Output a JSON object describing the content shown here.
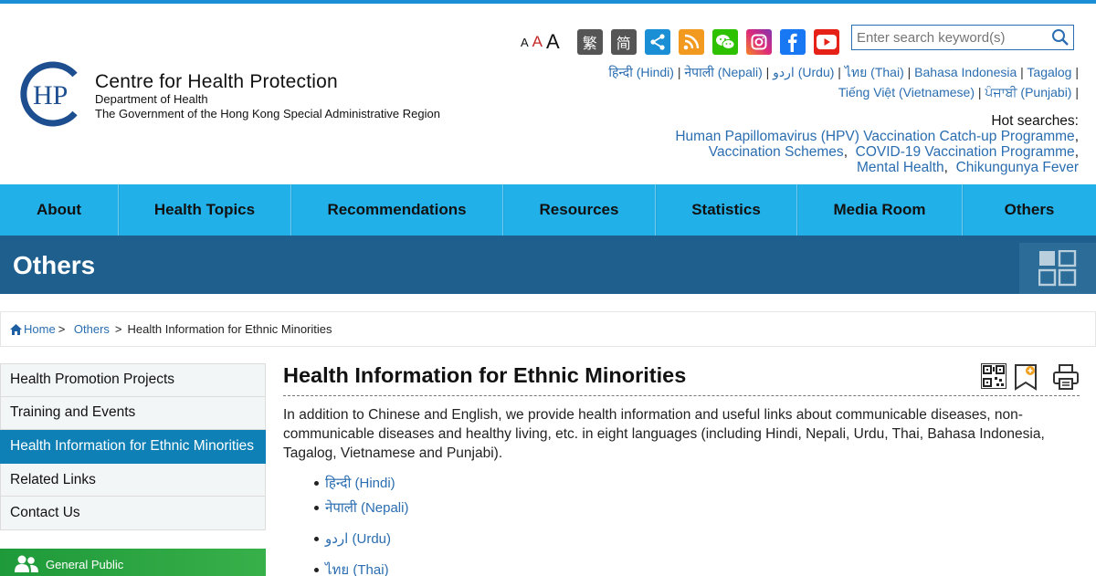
{
  "header": {
    "org_name": "Centre for Health Protection",
    "dept": "Department of Health",
    "gov": "The Government of the Hong Kong Special Administrative Region",
    "logo_letters": "HP",
    "font_sizes": [
      "A",
      "A",
      "A"
    ],
    "trad_chinese": "繁",
    "simp_chinese": "简",
    "search_placeholder": "Enter search keyword(s)",
    "languages_line1": [
      "हिन्दी (Hindi)",
      "नेपाली (Nepali)",
      "اردو (Urdu)",
      "ไทย (Thai)",
      "Bahasa Indonesia",
      "Tagalog"
    ],
    "languages_line2": [
      "Tiếng Việt (Vietnamese)",
      "ਪੰਜਾਬੀ (Punjabi)"
    ],
    "sep": "|",
    "hot_title": "Hot searches:",
    "hot_links": [
      "Human Papillomavirus (HPV) Vaccination Catch-up Programme",
      "Vaccination Schemes",
      "COVID-19 Vaccination Programme",
      "Mental Health",
      "Chikungunya Fever"
    ],
    "comma": ","
  },
  "nav": [
    "About",
    "Health Topics",
    "Recommendations",
    "Resources",
    "Statistics",
    "Media Room",
    "Others"
  ],
  "banner": {
    "title": "Others"
  },
  "breadcrumb": {
    "home": "Home",
    "sep": ">",
    "others": "Others",
    "current": "Health Information for Ethnic Minorities"
  },
  "sidebar": {
    "items": [
      "Health Promotion Projects",
      "Training and Events",
      "Health Information for Ethnic Minorities",
      "Related Links",
      "Contact Us"
    ],
    "green_label": "General Public"
  },
  "main": {
    "title": "Health Information for Ethnic Minorities",
    "intro": "In addition to Chinese and English, we provide health information and useful links about communicable diseases, non-communicable diseases and healthy living, etc. in eight languages (including Hindi, Nepali, Urdu, Thai, Bahasa Indonesia, Tagalog, Vietnamese and Punjabi).",
    "links": [
      "हिन्दी (Hindi)",
      "नेपाली (Nepali)",
      "اردو (Urdu)",
      "ไทย (Thai)"
    ]
  },
  "colors": {
    "nav": "#22b0e8",
    "banner": "#1e5f8e",
    "active": "#0f80b5",
    "link": "#2a6db0",
    "green": "#2ea843"
  }
}
